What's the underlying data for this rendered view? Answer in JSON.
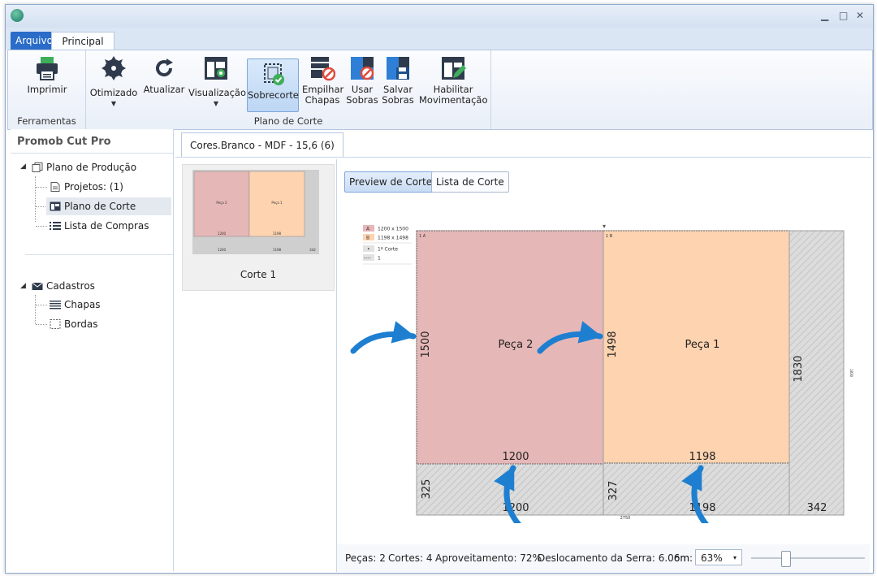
{
  "window": {
    "controls": {
      "minimize": "▁",
      "maximize": "□",
      "close": "✕"
    }
  },
  "ribbon": {
    "tabs": [
      {
        "label": "Arquivo"
      },
      {
        "label": "Principal"
      }
    ],
    "groups": {
      "tools": {
        "label": "Ferramentas",
        "buttons": {
          "print": "Imprimir"
        }
      },
      "plan": {
        "label": "Plano de Corte",
        "buttons": {
          "optimized": "Otimizado",
          "refresh": "Atualizar",
          "view": "Visualização",
          "overcut": "Sobrecorte",
          "stack_line1": "Empilhar",
          "stack_line2": "Chapas",
          "use_line1": "Usar",
          "use_line2": "Sobras",
          "save_line1": "Salvar",
          "save_line2": "Sobras",
          "move_line1": "Habilitar",
          "move_line2": "Movimentação"
        }
      }
    }
  },
  "left_panel": {
    "title": "Promob Cut Pro",
    "tree": {
      "production_plan": "Plano de Produção",
      "projects": "Projetos: (1)",
      "cut_plan": "Plano de Corte",
      "shopping_list": "Lista de Compras",
      "registers": "Cadastros",
      "sheets": "Chapas",
      "edges": "Bordas"
    }
  },
  "document": {
    "tab": "Cores.Branco - MDF - 15,6 (6)",
    "thumbnail": {
      "caption": "Corte 1"
    },
    "view_buttons": {
      "preview": "Preview de Corte",
      "list": "Lista de Corte"
    },
    "plan": {
      "legend": {
        "a_key": "A",
        "a_size": "1200 x 1500",
        "b_key": "B",
        "b_size": "1198 x 1498",
        "cut_key": "•",
        "cut_label": "1º Corte",
        "line_key": "----",
        "line_label": "1"
      },
      "piece2": {
        "label": "Peça 2",
        "tag": "1 A",
        "height": "1500",
        "width": "1200"
      },
      "piece1": {
        "label": "Peça 1",
        "tag": "1 B",
        "height": "1498",
        "width": "1198"
      },
      "sheet_height": "1830",
      "side_waste_width": "342",
      "bottom_left": {
        "height": "325",
        "width": "1200"
      },
      "bottom_right": {
        "height": "327",
        "width": "1198"
      },
      "sheet_width": "2750",
      "edge_small": "1830"
    },
    "colors": {
      "piece2": "#e6b7b7",
      "piece1": "#fdd3b0",
      "arrow": "#1e7fd0",
      "waste": "#d9d9d9"
    }
  },
  "status": {
    "pieces": "Peças: 2",
    "cuts": "Cortes: 4",
    "yield": "Aproveitamento: 72%",
    "saw": "Deslocamento da Serra: 6.06m",
    "zoom_label": "om:",
    "zoom_value": "63%",
    "zoom_level": 0.3
  }
}
